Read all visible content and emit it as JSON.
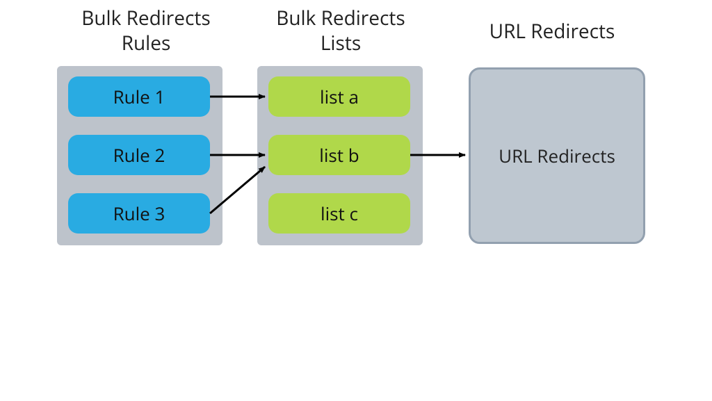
{
  "columns": {
    "rules": {
      "title_line1": "Bulk Redirects",
      "title_line2": "Rules",
      "items": [
        "Rule 1",
        "Rule 2",
        "Rule 3"
      ]
    },
    "lists": {
      "title_line1": "Bulk Redirects",
      "title_line2": "Lists",
      "items": [
        "list a",
        "list b",
        "list c"
      ]
    },
    "redirects": {
      "title": "URL Redirects",
      "box_label": "URL Redirects"
    }
  },
  "colors": {
    "container_bg": "#bdc3cb",
    "container_border": "#92a0af",
    "pill_blue": "#29abe2",
    "pill_green": "#b0d84a"
  }
}
